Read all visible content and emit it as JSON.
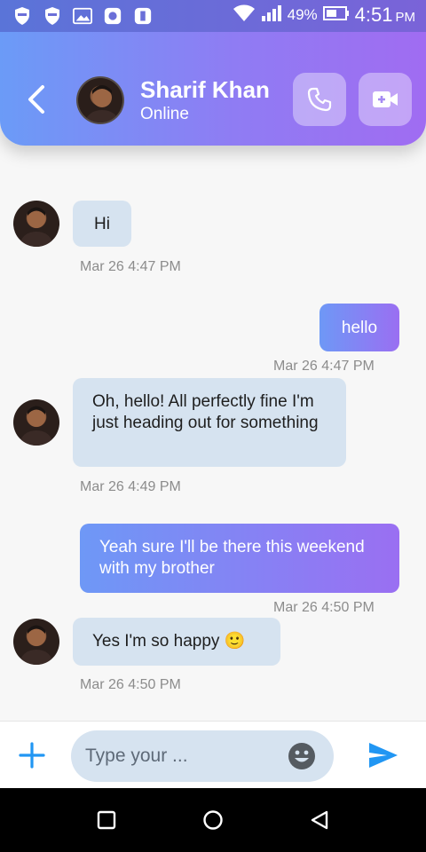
{
  "status_bar": {
    "battery_percent": "49%",
    "time": "4:51",
    "ampm": "PM"
  },
  "header": {
    "contact_name": "Sharif Khan",
    "contact_status": "Online"
  },
  "messages": [
    {
      "direction": "in",
      "text": "Hi",
      "timestamp": "Mar 26 4:47 PM"
    },
    {
      "direction": "out",
      "text": "hello",
      "timestamp": "Mar 26 4:47 PM"
    },
    {
      "direction": "in",
      "text": "Oh, hello! All perfectly fine I'm just heading out for something",
      "timestamp": "Mar 26 4:49 PM"
    },
    {
      "direction": "out",
      "text": "Yeah sure I'll be there this weekend with my brother",
      "timestamp": "Mar 26 4:50 PM"
    },
    {
      "direction": "in",
      "text": "Yes I'm so happy 🙂",
      "timestamp": "Mar 26 4:50 PM"
    }
  ],
  "composer": {
    "placeholder": "Type your ..."
  },
  "colors": {
    "header_gradient_start": "#6b9bf7",
    "header_gradient_end": "#a06cf2",
    "incoming_bubble": "#d6e3f0",
    "accent_blue": "#2196f3"
  }
}
